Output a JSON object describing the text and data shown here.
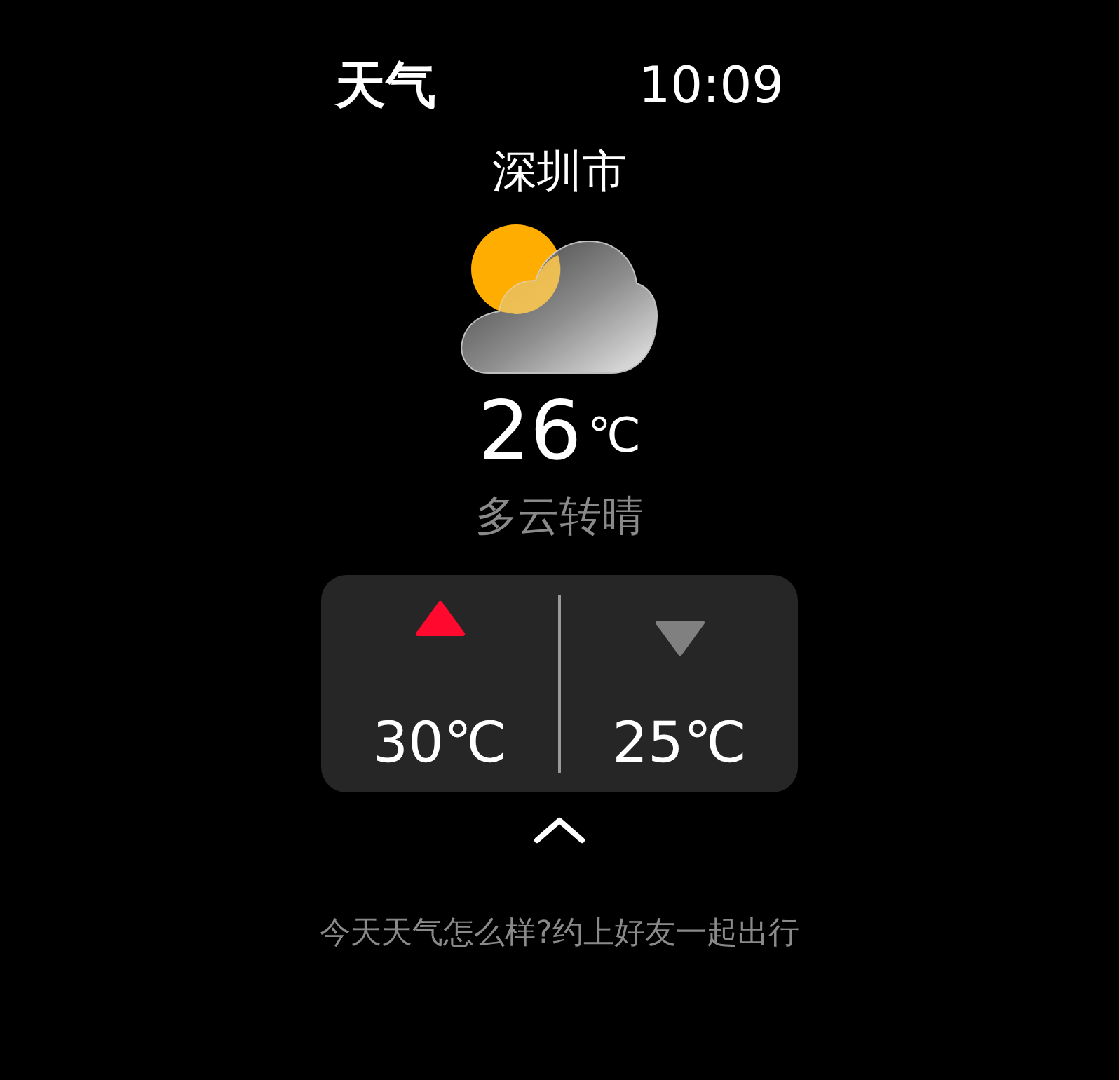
{
  "header": {
    "title": "天气",
    "time": "10:09"
  },
  "city": "深圳市",
  "current": {
    "temperature": "26",
    "unit": "℃",
    "condition": "多云转晴"
  },
  "range": [
    {
      "kind": "high",
      "value": "30℃"
    },
    {
      "kind": "low",
      "value": "25℃"
    }
  ],
  "tip": "今天天气怎么样?约上好友一起出行"
}
